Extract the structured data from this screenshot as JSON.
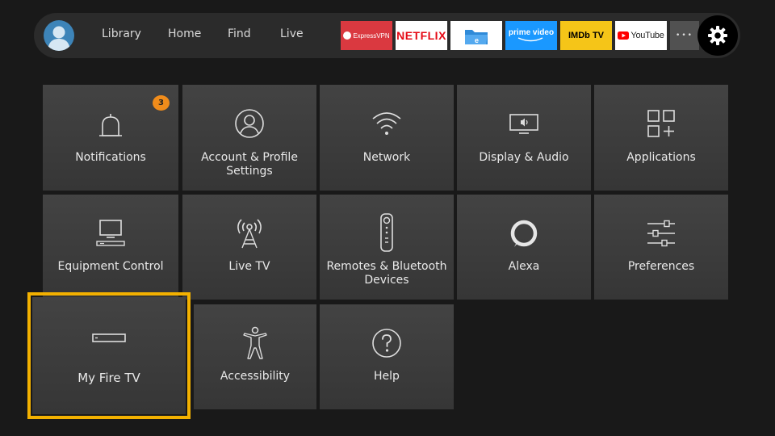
{
  "nav": {
    "tabs": [
      "Library",
      "Home",
      "Find",
      "Live"
    ]
  },
  "apps": [
    {
      "label": "ExpressVPN",
      "bg": "#da3940",
      "fg": "#ffffff"
    },
    {
      "label": "NETFLIX",
      "bg": "#ffffff",
      "fg": "#e50914"
    },
    {
      "label": "ES File Explorer",
      "bg": "#ffffff",
      "fg": "#2f8ad8"
    },
    {
      "label": "prime video",
      "bg": "#1a98ff",
      "fg": "#ffffff"
    },
    {
      "label": "IMDb TV",
      "bg": "#f5c518",
      "fg": "#000000"
    },
    {
      "label": "YouTube",
      "bg": "#ffffff",
      "fg": "#222222"
    }
  ],
  "more_glyph": "•••",
  "settings": [
    {
      "label": "Notifications",
      "icon": "bell-icon",
      "badge": "3"
    },
    {
      "label": "Account & Profile Settings",
      "icon": "user-icon"
    },
    {
      "label": "Network",
      "icon": "wifi-icon"
    },
    {
      "label": "Display & Audio",
      "icon": "display-audio-icon"
    },
    {
      "label": "Applications",
      "icon": "apps-icon"
    },
    {
      "label": "Equipment Control",
      "icon": "equipment-icon"
    },
    {
      "label": "Live TV",
      "icon": "antenna-icon"
    },
    {
      "label": "Remotes & Bluetooth Devices",
      "icon": "remote-icon"
    },
    {
      "label": "Alexa",
      "icon": "alexa-icon"
    },
    {
      "label": "Preferences",
      "icon": "sliders-icon"
    },
    {
      "label": "My Fire TV",
      "icon": "fire-tv-device-icon"
    },
    {
      "label": "Accessibility",
      "icon": "accessibility-icon"
    },
    {
      "label": "Help",
      "icon": "help-icon"
    }
  ],
  "colors": {
    "focus": "#f3b100",
    "badge": "#f08c1b"
  }
}
